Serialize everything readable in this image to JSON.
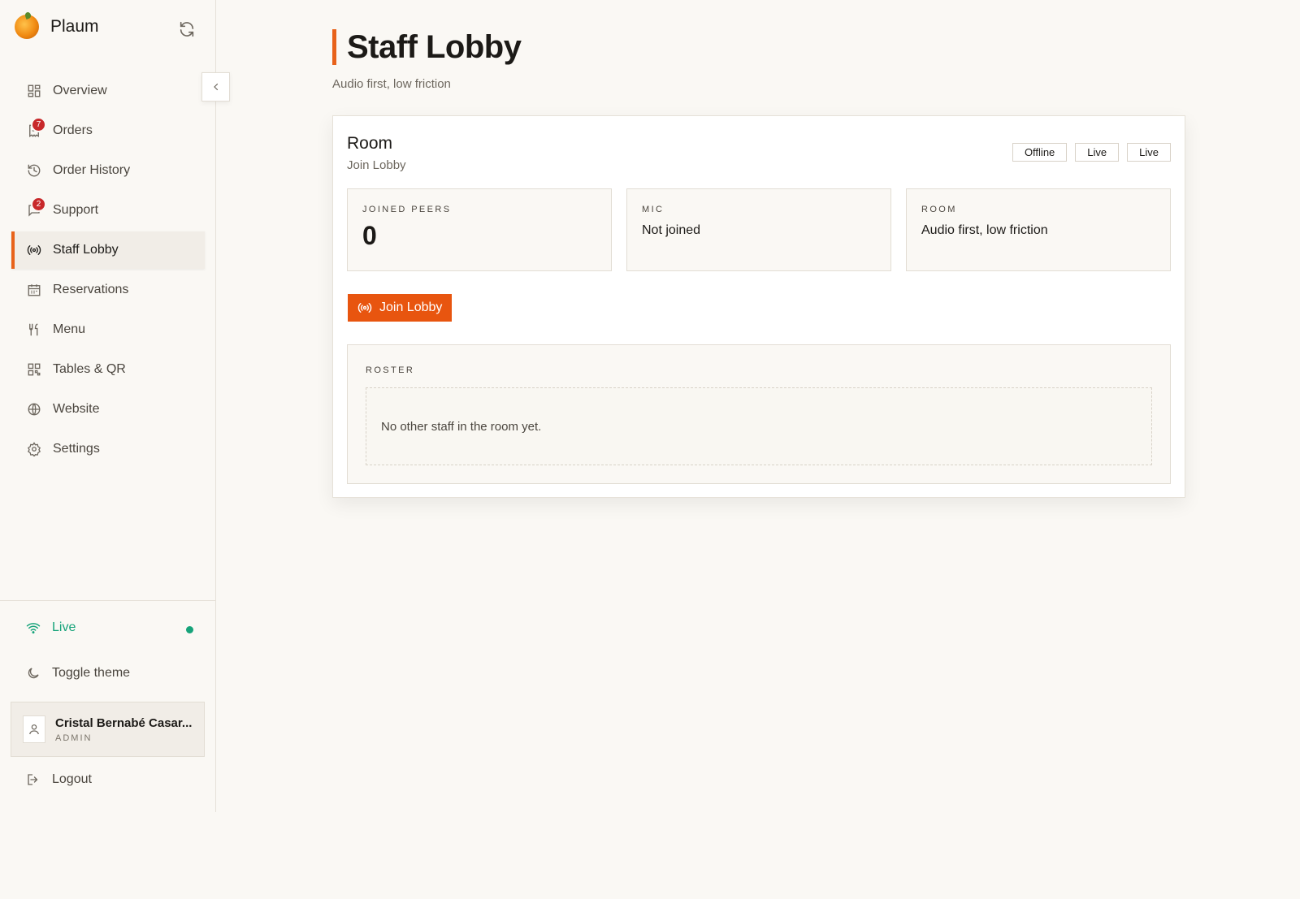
{
  "brand": {
    "name": "Plaum"
  },
  "sidebar": {
    "items": [
      {
        "label": "Overview"
      },
      {
        "label": "Orders",
        "badge": "7"
      },
      {
        "label": "Order History"
      },
      {
        "label": "Support",
        "badge": "2"
      },
      {
        "label": "Staff Lobby",
        "active": true
      },
      {
        "label": "Reservations"
      },
      {
        "label": "Menu"
      },
      {
        "label": "Tables & QR"
      },
      {
        "label": "Website"
      },
      {
        "label": "Settings"
      }
    ],
    "status_label": "Live",
    "theme_label": "Toggle theme",
    "user": {
      "name": "Cristal Bernabé Casar...",
      "role": "ADMIN"
    },
    "logout_label": "Logout"
  },
  "page": {
    "title": "Staff Lobby",
    "subtitle": "Audio first, low friction"
  },
  "room_card": {
    "title": "Room",
    "subtitle": "Join Lobby",
    "badges": [
      "Offline",
      "Live",
      "Live"
    ],
    "stats": [
      {
        "label": "JOINED PEERS",
        "value": "0"
      },
      {
        "label": "MIC",
        "value": "Not joined"
      },
      {
        "label": "ROOM",
        "value": "Audio first, low friction"
      }
    ],
    "join_button": "Join Lobby",
    "roster_label": "ROSTER",
    "roster_empty": "No other staff in the room yet."
  },
  "colors": {
    "accent": "#e8621a",
    "button": "#e8550f",
    "live": "#16a37a",
    "badge": "#c8282a",
    "background": "#faf8f4"
  }
}
